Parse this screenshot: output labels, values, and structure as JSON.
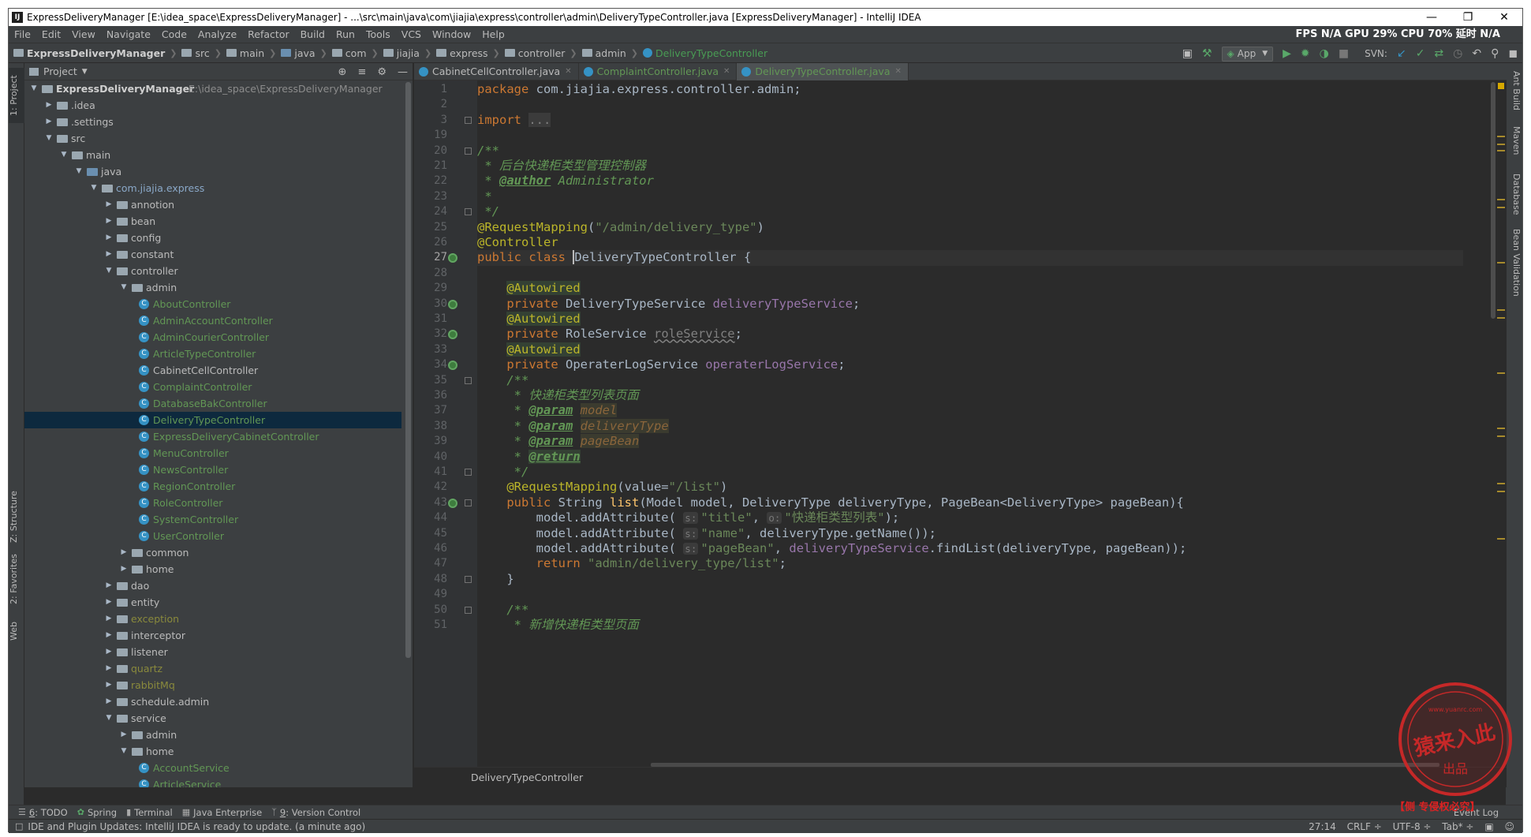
{
  "window": {
    "title": "ExpressDeliveryManager [E:\\idea_space\\ExpressDeliveryManager] - ...\\src\\main\\java\\com\\jiajia\\express\\controller\\admin\\DeliveryTypeController.java [ExpressDeliveryManager] - IntelliJ IDEA",
    "icon": "IJ"
  },
  "menu": [
    "File",
    "Edit",
    "View",
    "Navigate",
    "Code",
    "Analyze",
    "Refactor",
    "Build",
    "Run",
    "Tools",
    "VCS",
    "Window",
    "Help"
  ],
  "stats": "FPS N/A GPU 29% CPU 70% 延时 N/A",
  "breadcrumbs": [
    "ExpressDeliveryManager",
    "src",
    "main",
    "java",
    "com",
    "jiajia",
    "express",
    "controller",
    "admin",
    "DeliveryTypeController"
  ],
  "run_config": "App",
  "svn_label": "SVN:",
  "left_tabs": [
    "1: Project",
    "Z: Structure",
    "2: Favorites",
    "Web"
  ],
  "right_tabs": [
    "Ant Build",
    "Maven",
    "Database",
    "Bean Validation"
  ],
  "project": {
    "header": "Project",
    "tree": [
      {
        "label": "ExpressDeliveryManager",
        "path": "E:\\idea_space\\ExpressDeliveryManager",
        "indent": 0,
        "arrow": "▼",
        "kind": "folder",
        "style": "bold"
      },
      {
        "label": ".idea",
        "indent": 1,
        "arrow": "▶",
        "kind": "folder"
      },
      {
        "label": ".settings",
        "indent": 1,
        "arrow": "▶",
        "kind": "folder"
      },
      {
        "label": "src",
        "indent": 1,
        "arrow": "▼",
        "kind": "folder"
      },
      {
        "label": "main",
        "indent": 2,
        "arrow": "▼",
        "kind": "folder"
      },
      {
        "label": "java",
        "indent": 3,
        "arrow": "▼",
        "kind": "src"
      },
      {
        "label": "com.jiajia.express",
        "indent": 4,
        "arrow": "▼",
        "kind": "folder",
        "style": "pkg"
      },
      {
        "label": "annotion",
        "indent": 5,
        "arrow": "▶",
        "kind": "folder"
      },
      {
        "label": "bean",
        "indent": 5,
        "arrow": "▶",
        "kind": "folder"
      },
      {
        "label": "config",
        "indent": 5,
        "arrow": "▶",
        "kind": "folder"
      },
      {
        "label": "constant",
        "indent": 5,
        "arrow": "▶",
        "kind": "folder"
      },
      {
        "label": "controller",
        "indent": 5,
        "arrow": "▼",
        "kind": "folder"
      },
      {
        "label": "admin",
        "indent": 6,
        "arrow": "▼",
        "kind": "folder"
      },
      {
        "label": "AboutController",
        "indent": 7,
        "kind": "class",
        "style": "green"
      },
      {
        "label": "AdminAccountController",
        "indent": 7,
        "kind": "class",
        "style": "green"
      },
      {
        "label": "AdminCourierController",
        "indent": 7,
        "kind": "class",
        "style": "green"
      },
      {
        "label": "ArticleTypeController",
        "indent": 7,
        "kind": "class",
        "style": "green"
      },
      {
        "label": "CabinetCellController",
        "indent": 7,
        "kind": "class"
      },
      {
        "label": "ComplaintController",
        "indent": 7,
        "kind": "class",
        "style": "green"
      },
      {
        "label": "DatabaseBakController",
        "indent": 7,
        "kind": "class",
        "style": "green"
      },
      {
        "label": "DeliveryTypeController",
        "indent": 7,
        "kind": "class",
        "style": "green",
        "selected": true
      },
      {
        "label": "ExpressDeliveryCabinetController",
        "indent": 7,
        "kind": "class",
        "style": "green"
      },
      {
        "label": "MenuController",
        "indent": 7,
        "kind": "class",
        "style": "green"
      },
      {
        "label": "NewsController",
        "indent": 7,
        "kind": "class",
        "style": "green"
      },
      {
        "label": "RegionController",
        "indent": 7,
        "kind": "class",
        "style": "green"
      },
      {
        "label": "RoleController",
        "indent": 7,
        "kind": "class",
        "style": "green"
      },
      {
        "label": "SystemController",
        "indent": 7,
        "kind": "class",
        "style": "green"
      },
      {
        "label": "UserController",
        "indent": 7,
        "kind": "class",
        "style": "green"
      },
      {
        "label": "common",
        "indent": 6,
        "arrow": "▶",
        "kind": "folder"
      },
      {
        "label": "home",
        "indent": 6,
        "arrow": "▶",
        "kind": "folder"
      },
      {
        "label": "dao",
        "indent": 5,
        "arrow": "▶",
        "kind": "folder"
      },
      {
        "label": "entity",
        "indent": 5,
        "arrow": "▶",
        "kind": "folder"
      },
      {
        "label": "exception",
        "indent": 5,
        "arrow": "▶",
        "kind": "folder",
        "style": "olive"
      },
      {
        "label": "interceptor",
        "indent": 5,
        "arrow": "▶",
        "kind": "folder"
      },
      {
        "label": "listener",
        "indent": 5,
        "arrow": "▶",
        "kind": "folder"
      },
      {
        "label": "quartz",
        "indent": 5,
        "arrow": "▶",
        "kind": "folder",
        "style": "olive"
      },
      {
        "label": "rabbitMq",
        "indent": 5,
        "arrow": "▶",
        "kind": "folder",
        "style": "olive"
      },
      {
        "label": "schedule.admin",
        "indent": 5,
        "arrow": "▶",
        "kind": "folder"
      },
      {
        "label": "service",
        "indent": 5,
        "arrow": "▼",
        "kind": "folder"
      },
      {
        "label": "admin",
        "indent": 6,
        "arrow": "▶",
        "kind": "folder"
      },
      {
        "label": "home",
        "indent": 6,
        "arrow": "▼",
        "kind": "folder"
      },
      {
        "label": "AccountService",
        "indent": 7,
        "kind": "class",
        "style": "green"
      },
      {
        "label": "ArticleService",
        "indent": 7,
        "kind": "class",
        "style": "green"
      }
    ]
  },
  "tabs": [
    {
      "label": "CabinetCellController.java",
      "style": "normal"
    },
    {
      "label": "ComplaintController.java",
      "style": "green"
    },
    {
      "label": "DeliveryTypeController.java",
      "style": "green",
      "active": true
    }
  ],
  "editor": {
    "current_line": "27",
    "lines": [
      {
        "n": "1",
        "html": "<span class='kw'>package</span> com.jiajia.express.controller.admin;"
      },
      {
        "n": "2",
        "html": ""
      },
      {
        "n": "3",
        "html": "<span class='kw'>import</span> <span class='grey' style='background:#3b3b3b'>...</span>",
        "fold": true
      },
      {
        "n": "19",
        "html": ""
      },
      {
        "n": "20",
        "html": "<span class='cmt'>/**</span>",
        "fold": true
      },
      {
        "n": "21",
        "html": "<span class='cmt'> * 后台快递柜类型管理控制器</span>"
      },
      {
        "n": "22",
        "html": "<span class='cmt'> * </span><span class='doctag'>@author</span><span class='cmt'> Administrator</span>"
      },
      {
        "n": "23",
        "html": "<span class='cmt'> *</span>"
      },
      {
        "n": "24",
        "html": "<span class='cmt'> */</span>",
        "fold": true
      },
      {
        "n": "25",
        "html": "<span class='ann'>@RequestMapping</span>(<span class='str'>\"/admin/delivery_type\"</span>)"
      },
      {
        "n": "26",
        "html": "<span class='ann'>@Controller</span>"
      },
      {
        "n": "27",
        "html": "<span class='kw'>public class</span> <span class='caret'></span>DeliveryTypeController {",
        "icon": true
      },
      {
        "n": "28",
        "html": ""
      },
      {
        "n": "29",
        "html": "    <span class='annbg'>@Autowired</span>"
      },
      {
        "n": "30",
        "html": "    <span class='kw'>private</span> DeliveryTypeService <span class='fld'>deliveryTypeService</span>;",
        "icon": true
      },
      {
        "n": "31",
        "html": "    <span class='annbg'>@Autowired</span>"
      },
      {
        "n": "32",
        "html": "    <span class='kw'>private</span> RoleService <span class='fld' style='color:#808080;text-decoration:underline wavy #808080'>roleService</span>;",
        "icon": true
      },
      {
        "n": "33",
        "html": "    <span class='annbg'>@Autowired</span>"
      },
      {
        "n": "34",
        "html": "    <span class='kw'>private</span> OperaterLogService <span class='fld'>operaterLogService</span>;",
        "icon": true
      },
      {
        "n": "35",
        "html": "    <span class='cmt'>/**</span>",
        "fold": true
      },
      {
        "n": "36",
        "html": "    <span class='cmt'> * 快递柜类型列表页面</span>"
      },
      {
        "n": "37",
        "html": "    <span class='cmt'> * </span><span class='doctag'>@param</span> <span class='docparam'>model</span>"
      },
      {
        "n": "38",
        "html": "    <span class='cmt'> * </span><span class='doctag'>@param</span> <span class='docparam'>deliveryType</span>"
      },
      {
        "n": "39",
        "html": "    <span class='cmt'> * </span><span class='doctag'>@param</span> <span class='docparam'>pageBean</span>"
      },
      {
        "n": "40",
        "html": "    <span class='cmt'> * </span><span class='doctag' style='background:#344134'>@return</span>"
      },
      {
        "n": "41",
        "html": "    <span class='cmt'> */</span>",
        "fold": true
      },
      {
        "n": "42",
        "html": "    <span class='ann'>@RequestMapping</span>(value=<span class='str'>\"/list\"</span>)"
      },
      {
        "n": "43",
        "html": "    <span class='kw'>public</span> String <span class='mth'>list</span>(Model model, DeliveryType deliveryType, PageBean&lt;DeliveryType&gt; pageBean){",
        "icon": true,
        "fold": true
      },
      {
        "n": "44",
        "html": "        model.addAttribute( <span class='hint'>s:</span><span class='str'>\"title\"</span>, <span class='hint'>o:</span><span class='str'>\"快递柜类型列表\"</span>);"
      },
      {
        "n": "45",
        "html": "        model.addAttribute( <span class='hint'>s:</span><span class='str'>\"name\"</span>, deliveryType.getName());"
      },
      {
        "n": "46",
        "html": "        model.addAttribute( <span class='hint'>s:</span><span class='str'>\"pageBean\"</span>, <span class='fld'>deliveryTypeService</span>.findList(deliveryType, pageBean));"
      },
      {
        "n": "47",
        "html": "        <span class='kw'>return</span> <span class='str'>\"admin/delivery_type/list\"</span>;"
      },
      {
        "n": "48",
        "html": "    }",
        "fold": true
      },
      {
        "n": "49",
        "html": ""
      },
      {
        "n": "50",
        "html": "    <span class='cmt'>/**</span>",
        "fold": true
      },
      {
        "n": "51",
        "html": "    <span class='cmt'> * 新增快递柜类型页面</span>"
      }
    ]
  },
  "editor_breadcrumb": "DeliveryTypeController",
  "bottom_tabs": [
    {
      "num": "6",
      "label": ": TODO"
    },
    {
      "label": "Spring"
    },
    {
      "label": "Terminal"
    },
    {
      "label": "Java Enterprise"
    },
    {
      "num": "9",
      "label": ": Version Control"
    }
  ],
  "event_log": "Event Log",
  "status": {
    "message": "IDE and Plugin Updates: IntelliJ IDEA is ready to update. (a minute ago)",
    "position": "27:14",
    "line_sep": "CRLF ÷",
    "encoding": "UTF-8 ÷",
    "indent": "Tab* ÷"
  },
  "watermark": {
    "text": "猿来入此",
    "sub": "出品",
    "url": "www.yuanrc.com",
    "banner": "【侧 专侵权必究】"
  }
}
